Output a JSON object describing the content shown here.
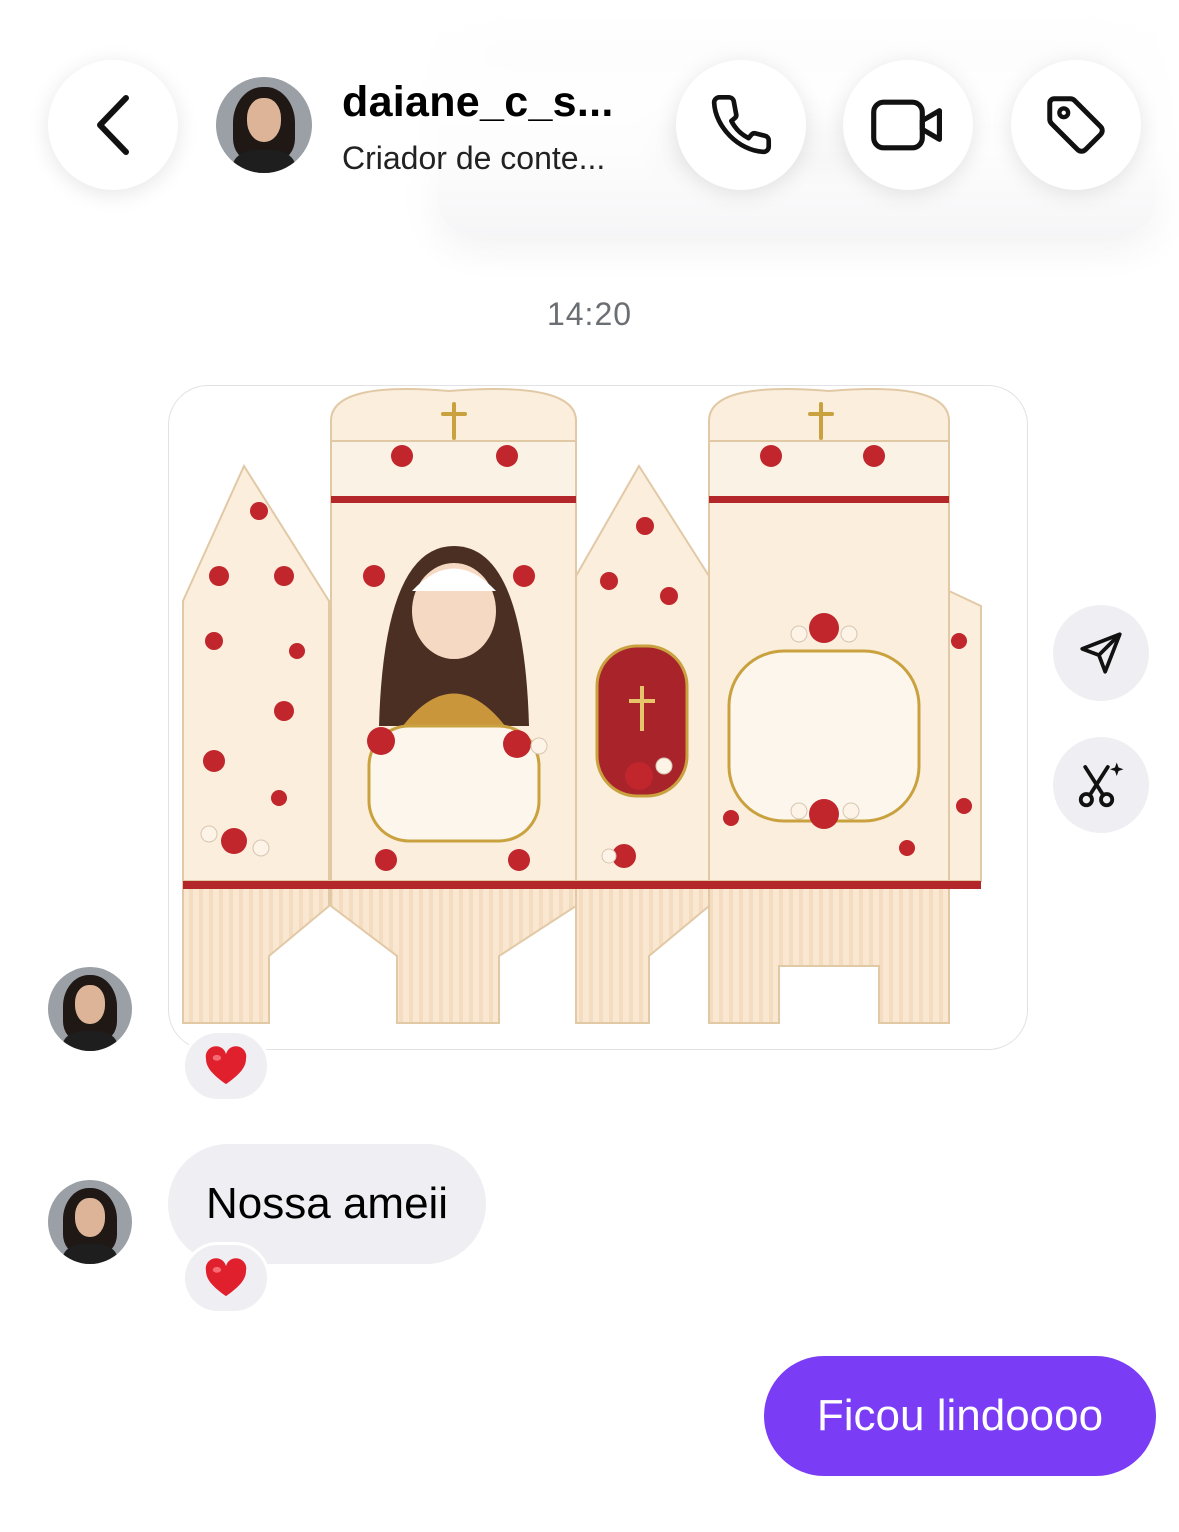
{
  "header": {
    "contact_name": "daiane_c_s...",
    "contact_subtitle": "Criador de conte...",
    "back_icon": "chevron-left-icon",
    "call_icon": "phone-icon",
    "video_icon": "video-camera-icon",
    "tag_icon": "tag-icon"
  },
  "conversation": {
    "timestamp": "14:20",
    "messages": [
      {
        "type": "image",
        "sender": "daiane_c_s...",
        "description_icon": "gift-box-template-image",
        "reaction": "❤️"
      },
      {
        "type": "text",
        "sender": "daiane_c_s...",
        "text": "Nossa ameii",
        "reaction": "❤️"
      },
      {
        "type": "text",
        "sender": "me",
        "text": "Ficou lindoooo"
      }
    ]
  },
  "side_actions": {
    "share_icon": "send-icon",
    "edit_icon": "scissors-sparkle-icon"
  },
  "colors": {
    "outgoing_bubble": "#7a3cf5",
    "incoming_bubble": "#efeff3",
    "timestamp": "#6b6e73"
  }
}
